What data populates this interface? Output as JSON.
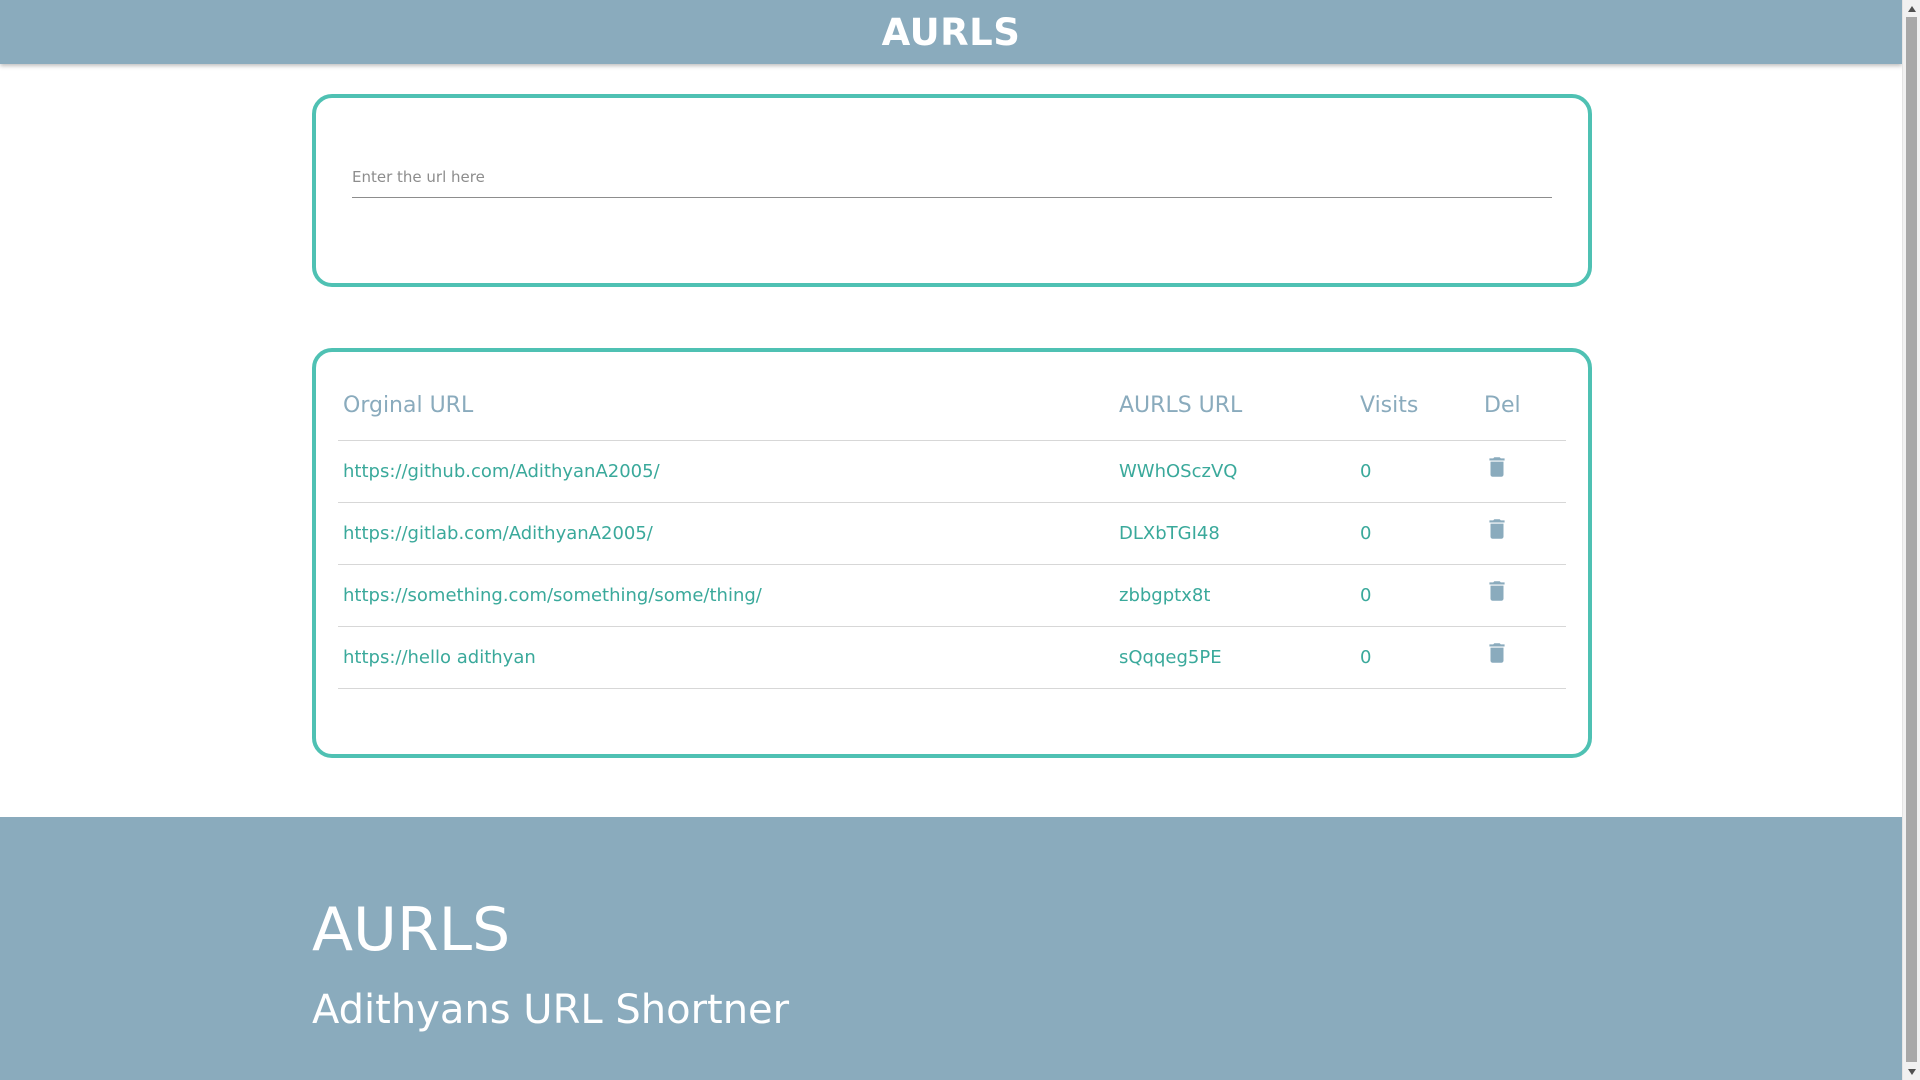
{
  "header": {
    "brand": "AURLS"
  },
  "url_form": {
    "placeholder": "Enter the url here",
    "value": ""
  },
  "table": {
    "headers": {
      "original": "Orginal URL",
      "short": "AURLS URL",
      "visits": "Visits",
      "del": "Del"
    },
    "rows": [
      {
        "original": "https://github.com/AdithyanA2005/",
        "short": "WWhOSczVQ",
        "visits": "0"
      },
      {
        "original": "https://gitlab.com/AdithyanA2005/",
        "short": "DLXbTGI48",
        "visits": "0"
      },
      {
        "original": "https://something.com/something/some/thing/",
        "short": "zbbgptx8t",
        "visits": "0"
      },
      {
        "original": "https://hello adithyan",
        "short": "sQqqeg5PE",
        "visits": "0"
      }
    ]
  },
  "footer": {
    "title": "AURLS",
    "subtitle": "Adithyans URL Shortner"
  },
  "icons": {
    "delete": "trash-icon",
    "scroll_up": "triangle-up-icon",
    "scroll_down": "triangle-down-icon"
  },
  "colors": {
    "primary": "#8aabbd",
    "accent": "#4fc1b3",
    "link": "#3aa99b"
  }
}
